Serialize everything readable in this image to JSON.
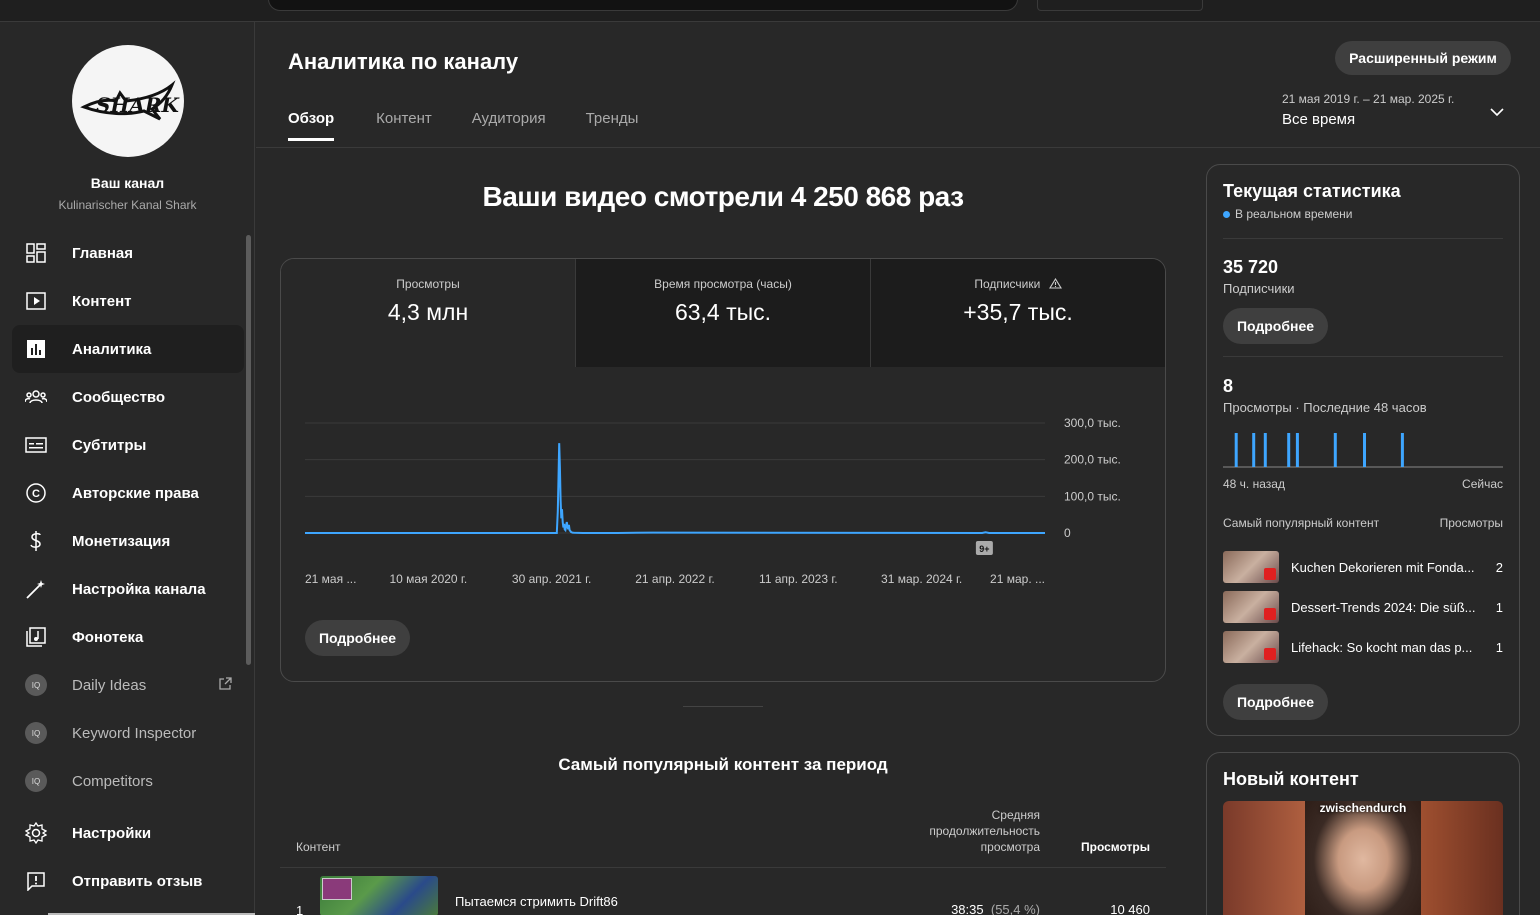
{
  "sidebar": {
    "channel_name": "Ваш канал",
    "channel_sub": "Kulinarischer Kanal Shark",
    "logo_text": "SHARK",
    "items": [
      {
        "label": "Главная",
        "icon": "dashboard-icon"
      },
      {
        "label": "Контент",
        "icon": "video-icon"
      },
      {
        "label": "Аналитика",
        "icon": "analytics-icon"
      },
      {
        "label": "Сообщество",
        "icon": "community-icon"
      },
      {
        "label": "Субтитры",
        "icon": "subtitles-icon"
      },
      {
        "label": "Авторские права",
        "icon": "copyright-icon"
      },
      {
        "label": "Монетизация",
        "icon": "dollar-icon"
      },
      {
        "label": "Настройка канала",
        "icon": "magic-wand-icon"
      },
      {
        "label": "Фонотека",
        "icon": "audio-library-icon"
      }
    ],
    "external": [
      {
        "label": "Daily Ideas",
        "icon": "vidiq-icon"
      },
      {
        "label": "Keyword Inspector",
        "icon": "vidiq-icon"
      },
      {
        "label": "Competitors",
        "icon": "vidiq-icon"
      }
    ],
    "bottom": [
      {
        "label": "Настройки",
        "icon": "gear-icon"
      },
      {
        "label": "Отправить отзыв",
        "icon": "feedback-icon"
      }
    ]
  },
  "header": {
    "title": "Аналитика по каналу",
    "advanced_button": "Расширенный режим",
    "tabs": [
      "Обзор",
      "Контент",
      "Аудитория",
      "Тренды"
    ],
    "period_range": "21 мая 2019 г. – 21 мар. 2025 г.",
    "period_value": "Все время"
  },
  "overview": {
    "headline": "Ваши видео смотрели 4 250 868 раз",
    "metrics": [
      {
        "label": "Просмотры",
        "value": "4,3 млн"
      },
      {
        "label": "Время просмотра (часы)",
        "value": "63,4 тыс."
      },
      {
        "label": "Подписчики",
        "value": "+35,7 тыс."
      }
    ],
    "more_button": "Подробнее",
    "marker_badge": "9+"
  },
  "chart_data": {
    "type": "line",
    "x_tick_labels": [
      "21 мая ...",
      "10 мая 2020 г.",
      "30 апр. 2021 г.",
      "21 апр. 2022 г.",
      "11 апр. 2023 г.",
      "31 мар. 2024 г.",
      "21 мар. ..."
    ],
    "y_tick_labels": [
      "300,0 тыс.",
      "200,0 тыс.",
      "100,0 тыс.",
      "0"
    ],
    "y_ticks": [
      300000,
      200000,
      100000,
      0
    ],
    "ylim": [
      0,
      300000
    ],
    "x_range_days": [
      0,
      2131
    ],
    "series": [
      {
        "x_days": [
          0,
          700,
          725,
          728,
          730,
          732,
          734,
          736,
          738,
          740,
          742,
          744,
          746,
          748,
          750,
          752,
          754,
          756,
          758,
          760,
          762,
          766,
          770,
          775,
          800,
          900,
          1000,
          1950,
          1960,
          1970,
          2131
        ],
        "values": [
          0,
          0,
          0,
          60000,
          150000,
          245000,
          180000,
          90000,
          40000,
          65000,
          30000,
          15000,
          25000,
          10000,
          8000,
          20000,
          30000,
          18000,
          10000,
          22000,
          8000,
          3000,
          1000,
          500,
          0,
          0,
          1000,
          0,
          2000,
          0,
          0
        ],
        "color": "#3ea6ff"
      }
    ],
    "grid": true
  },
  "popular": {
    "title": "Самый популярный контент за период",
    "col_content": "Контент",
    "col_avg": "Средняя продолжительность просмотра",
    "col_views": "Просмотры",
    "rows": [
      {
        "num": "1",
        "title": "Пытаемся стримить Drift86",
        "avg": "38:35",
        "avg_pct": "(55,4 %)",
        "views": "10 460"
      }
    ]
  },
  "realtime": {
    "title": "Текущая статистика",
    "live": "В реальном времени",
    "subs_value": "35 720",
    "subs_label": "Подписчики",
    "more_button": "Подробнее",
    "views_value": "8",
    "views_label": "Просмотры · Последние 48 часов",
    "spark_from": "48 ч. назад",
    "spark_to": "Сейчас",
    "spark_hours_ago": [
      46,
      43,
      41,
      37,
      35.5,
      29,
      24,
      17.5
    ],
    "spark_counts": [
      1,
      1,
      1,
      1,
      1,
      1,
      1,
      1
    ],
    "top_label": "Самый популярный контент",
    "top_views_label": "Просмотры",
    "top": [
      {
        "title": "Kuchen Dekorieren mit Fonda...",
        "views": "2"
      },
      {
        "title": "Dessert-Trends 2024: Die süß...",
        "views": "1"
      },
      {
        "title": "Lifehack: So kocht man das p...",
        "views": "1"
      }
    ],
    "more_button2": "Подробнее"
  },
  "new_content": {
    "title": "Новый контент",
    "thumb_caption": "zwischendurch"
  },
  "colors": {
    "accent": "#3ea6ff",
    "bg": "#282828",
    "card_dark": "#1c1c1c",
    "button": "#3f3f3f"
  }
}
